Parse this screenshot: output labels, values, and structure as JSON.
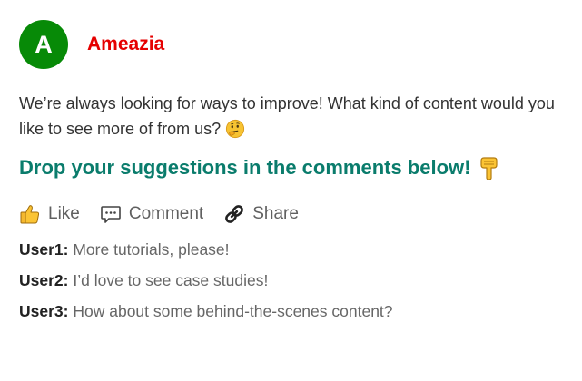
{
  "post": {
    "avatar_letter": "A",
    "author": "Ameazia",
    "body": "We’re always looking for ways to improve! What kind of content would you like to see more of from us?",
    "body_emoji": "thinking-face-icon",
    "cta": "Drop your suggestions in the comments below!",
    "cta_emoji": "backhand-index-pointing-down-icon"
  },
  "actions": {
    "like_label": "Like",
    "comment_label": "Comment",
    "share_label": "Share"
  },
  "comments": [
    {
      "user": "User1:",
      "text": "More tutorials, please!"
    },
    {
      "user": "User2:",
      "text": "I’d love to see case studies!"
    },
    {
      "user": "User3:",
      "text": "How about some behind-the-scenes content?"
    }
  ],
  "colors": {
    "avatar": "#078a07",
    "author": "#e50000",
    "cta": "#0a7c6c",
    "action_text": "#606060"
  }
}
